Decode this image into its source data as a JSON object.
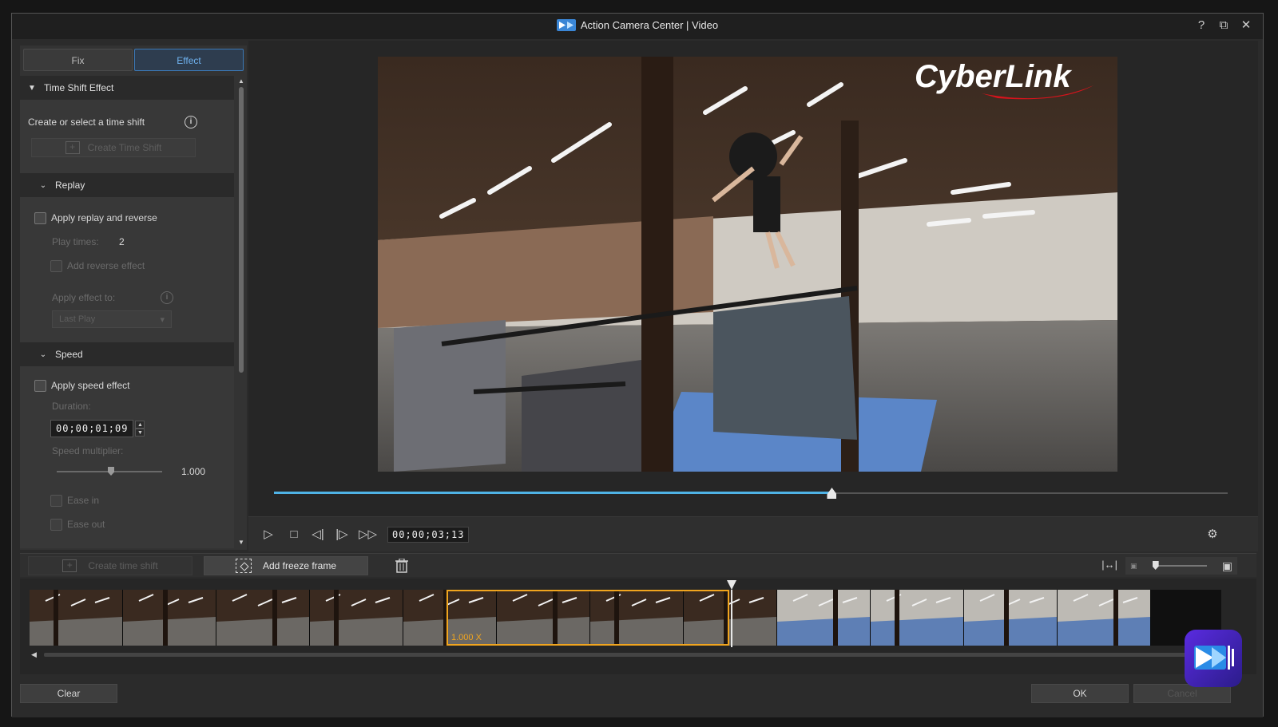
{
  "window": {
    "title": "Action Camera Center  |  Video"
  },
  "window_buttons": {
    "help": "?",
    "restore": "⧉",
    "close": "✕"
  },
  "tabs": [
    {
      "label": "Fix"
    },
    {
      "label": "Effect"
    }
  ],
  "time_shift": {
    "header": "Time Shift Effect",
    "prompt": "Create or select a time shift",
    "create_button": "Create Time Shift"
  },
  "replay": {
    "header": "Replay",
    "apply_label": "Apply replay and reverse",
    "play_times_label": "Play times:",
    "play_times_value": "2",
    "reverse_label": "Add reverse effect",
    "apply_to_label": "Apply effect to:",
    "apply_to_value": "Last Play"
  },
  "speed": {
    "header": "Speed",
    "apply_label": "Apply speed effect",
    "duration_label": "Duration:",
    "duration_value": "00;00;01;09",
    "multiplier_label": "Speed multiplier:",
    "multiplier_value": "1.000",
    "ease_in_label": "Ease in",
    "ease_out_label": "Ease out"
  },
  "preview": {
    "logo_text": "CyberLink",
    "timecode": "00;00;03;13",
    "progress": 0.585
  },
  "timeline": {
    "create_time_shift": "Create time shift",
    "add_freeze_frame": "Add freeze frame",
    "selection_label": "1.000 X"
  },
  "footer": {
    "clear": "Clear",
    "ok": "OK",
    "cancel": "Cancel"
  },
  "colors": {
    "accent": "#4fb3e6",
    "selection": "#f1a51e",
    "tab_active": "#6fb2ef"
  }
}
